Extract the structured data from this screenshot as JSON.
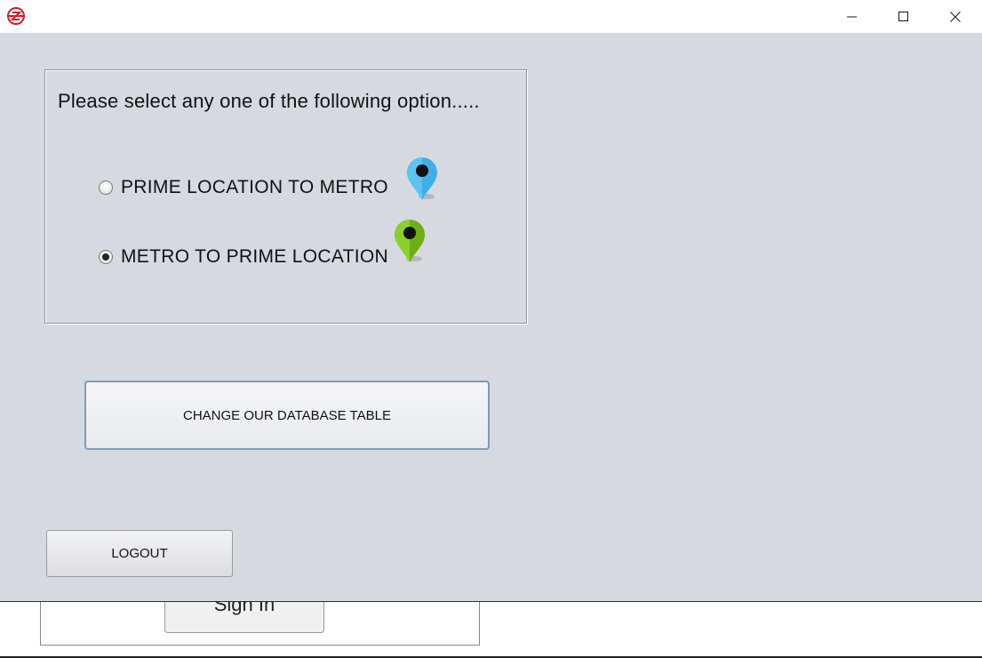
{
  "background_window": {
    "signin_label": "Sign In"
  },
  "titlebar": {
    "app_icon": "metro-logo-icon",
    "minimize_icon": "minimize-icon",
    "maximize_icon": "maximize-icon",
    "close_icon": "close-icon"
  },
  "options": {
    "prompt": "Please select any one of the following option.....",
    "items": [
      {
        "label": "PRIME LOCATION TO METRO",
        "selected": false,
        "icon": "blue-location-pin-icon",
        "color": "#3fb0e6"
      },
      {
        "label": "METRO TO PRIME LOCATION",
        "selected": true,
        "icon": "green-location-pin-icon",
        "color": "#7fc11e"
      }
    ]
  },
  "buttons": {
    "change_db": "CHANGE OUR DATABASE TABLE",
    "logout": "LOGOUT"
  },
  "colors": {
    "window_bg": "#d7d9e0",
    "logo_red": "#d0202a"
  }
}
